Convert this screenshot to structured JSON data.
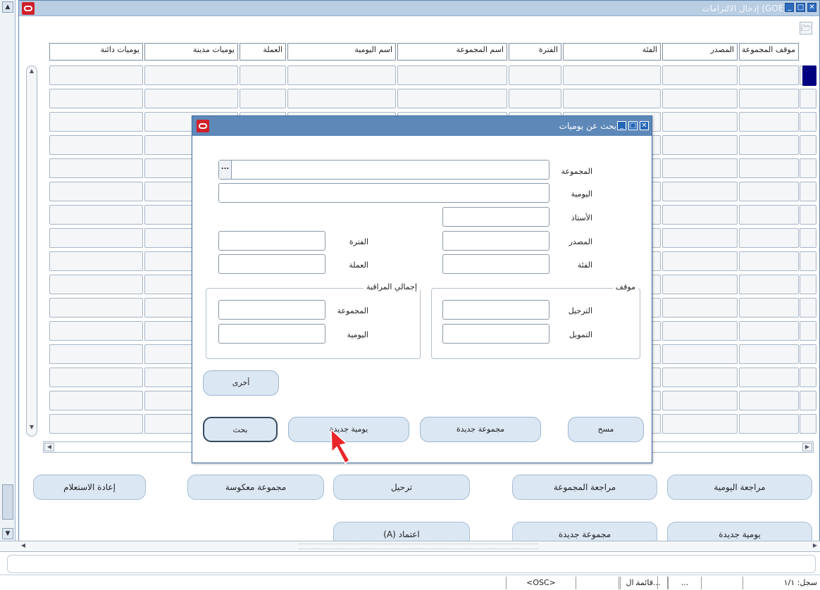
{
  "window": {
    "title": "إدخال الالتزامات (GOE)",
    "toolbar_icon": "folder-open-icon"
  },
  "grid": {
    "columns": [
      "موقف المجموعة",
      "المصدر",
      "الفئة",
      "الفترة",
      "اسم المجموعة",
      "اسم اليومية",
      "العملة",
      "يوميات مدينة",
      "يوميات دائنة"
    ],
    "rows": 16
  },
  "actions": {
    "row1": [
      "مراجعة اليومية",
      "مراجعة المجموعة",
      "ترحيل",
      "مجموعة معكوسة",
      "إعادة الاستعلام"
    ],
    "row2": [
      "يومية جديدة",
      "مجموعة جديدة",
      "اعتماد (A)"
    ]
  },
  "dialog": {
    "title": "بحث عن يوميات",
    "fields": {
      "batch": {
        "label": "المجموعة",
        "value": "",
        "lov": "..."
      },
      "journal": {
        "label": "اليومية",
        "value": ""
      },
      "ledger": {
        "label": "الأستاذ",
        "value": ""
      },
      "source": {
        "label": "المصدر",
        "value": ""
      },
      "category": {
        "label": "الفئة",
        "value": ""
      },
      "period": {
        "label": "الفترة",
        "value": ""
      },
      "currency": {
        "label": "العملة",
        "value": ""
      }
    },
    "status_group": {
      "title": "موقف",
      "posting": {
        "label": "الترحيل",
        "value": ""
      },
      "funds": {
        "label": "التمويل",
        "value": ""
      }
    },
    "control_group": {
      "title": "إجمالي المراقبة",
      "batch": {
        "label": "المجموعة",
        "value": ""
      },
      "journal": {
        "label": "اليومية",
        "value": ""
      }
    },
    "buttons": {
      "more": "أخرى",
      "clear": "مسح",
      "new_batch": "مجموعة جديدة",
      "new_journal": "يومية جديدة",
      "find": "بحث"
    }
  },
  "status_bar": {
    "record": "سجل: ١/١",
    "field2": "...",
    "field3": "قائمة ال...",
    "field4": "<OSC>"
  },
  "colors": {
    "title_bar": "#b9cde3",
    "dialog_title": "#5d88b8",
    "row_indicator": "#000080",
    "button_fill": "#dbe7f3",
    "oracle_red": "#d0202a"
  }
}
